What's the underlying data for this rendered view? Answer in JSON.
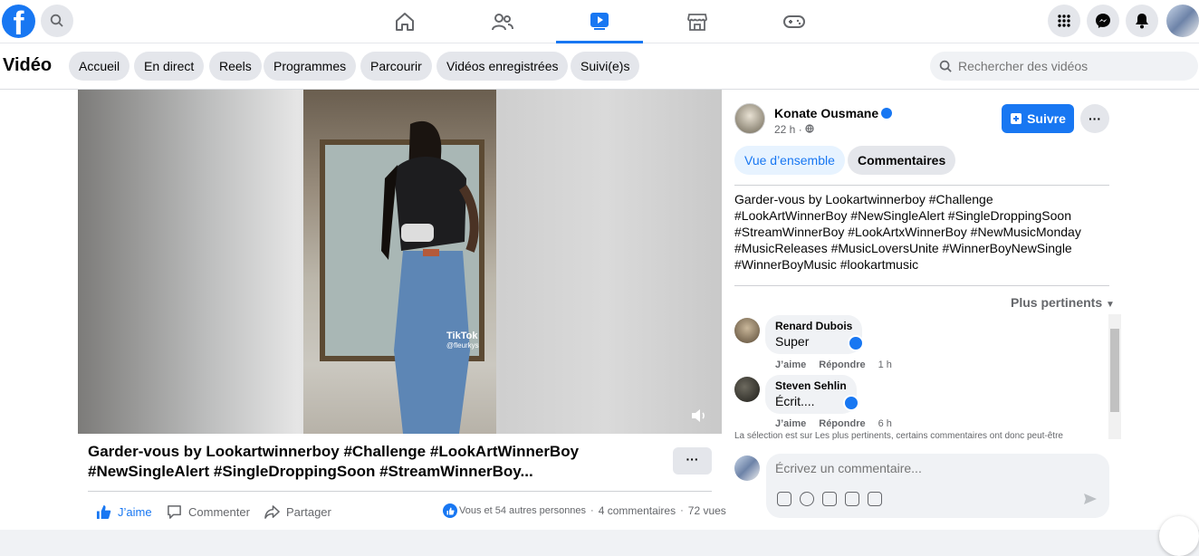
{
  "header": {
    "logo": "f",
    "search_icon": "search-icon",
    "nav": [
      "home-icon",
      "friends-icon",
      "watch-icon",
      "marketplace-icon",
      "gaming-icon"
    ],
    "active_nav": "watch-icon",
    "right_icons": [
      "menu-grid-icon",
      "messenger-icon",
      "notifications-icon",
      "avatar"
    ]
  },
  "subnav": {
    "title": "Vidéo",
    "chips": [
      "Accueil",
      "En direct",
      "Reels",
      "Programmes",
      "Parcourir",
      "Vidéos enregistrées",
      "Suivi(e)s"
    ],
    "search_placeholder": "Rechercher des vidéos"
  },
  "video": {
    "watermark": "TikTok",
    "watermark_handle": "@fleurkys",
    "title_line1": "Garder-vous by Lookartwinnerboy #Challenge #LookArtWinnerBoy",
    "title_line2": "#NewSingleAlert #SingleDroppingSoon #StreamWinnerBoy...",
    "more": "···"
  },
  "actions": {
    "like": "J’aime",
    "comment": "Commenter",
    "share": "Partager",
    "reactions": "Vous et 54 autres personnes",
    "comments_count": "4 commentaires",
    "views": "72 vues",
    "sep": "·"
  },
  "sidebar": {
    "author": "Konate Ousmane",
    "time": "22 h ·",
    "follow": "Suivre",
    "more": "···",
    "tab_overview": "Vue d’ensemble",
    "tab_comments": "Commentaires",
    "description_l1": "Garder-vous by Lookartwinnerboy #Challenge",
    "description_l2": "#LookArtWinnerBoy #NewSingleAlert #SingleDroppingSoon",
    "description_l3": "#StreamWinnerBoy #LookArtxWinnerBoy #NewMusicMonday",
    "description_l4": "#MusicReleases #MusicLoversUnite #WinnerBoyNewSingle",
    "description_l5": "#WinnerBoyMusic #lookartmusic",
    "sort": "Plus pertinents",
    "comments": [
      {
        "name": "Renard Dubois",
        "text": "Super",
        "like": "J’aime",
        "reply": "Répondre",
        "time": "1 h"
      },
      {
        "name": "Steven Sehlin",
        "text": "Écrit....",
        "like": "J’aime",
        "reply": "Répondre",
        "time": "6 h"
      }
    ],
    "selection_note": "La sélection est sur Les plus pertinents, certains commentaires ont donc peut-être",
    "comment_placeholder": "Écrivez un commentaire..."
  },
  "colors": {
    "accent": "#1877f2",
    "chip_bg": "#e4e6eb",
    "page_bg": "#f0f2f5"
  }
}
